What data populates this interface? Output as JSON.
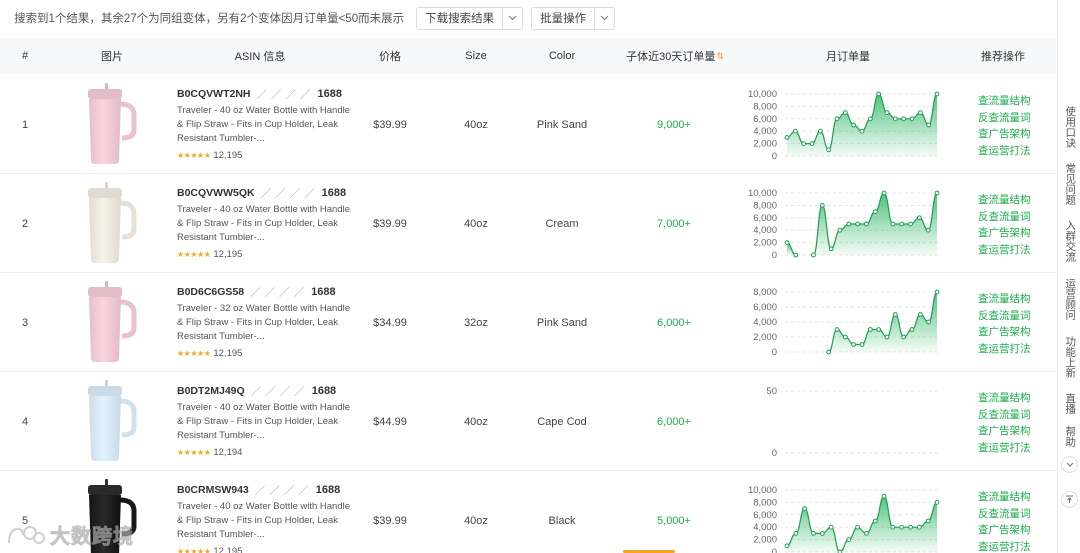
{
  "topbar": {
    "summary": "搜索到1个结果，其余27个为同组变体，另有2个变体因月订单量<50而未展示",
    "download_label": "下载搜索结果",
    "batch_label": "批量操作"
  },
  "headers": {
    "index": "#",
    "image": "图片",
    "asin_info": "ASIN 信息",
    "price": "价格",
    "size": "Size",
    "color": "Color",
    "sales30": "子体近30天订单量",
    "monthly": "月订单量",
    "actions": "推荐操作"
  },
  "action_labels": [
    "查流量结构",
    "反查流量词",
    "查广告架构",
    "查运营打法"
  ],
  "rows": [
    {
      "index": "1",
      "asin": "B0CQVWT2NH",
      "tag": "1688",
      "title": "Traveler - 40 oz Water Bottle with Handle & Flip Straw - Fits in Cup Holder, Leak Resistant Tumbler-...",
      "stars": "★★★★★",
      "reviews": "12,195",
      "price": "$39.99",
      "size": "40oz",
      "color": "Pink Sand",
      "sales": "9,000+",
      "bottle_color": "#eec9d4",
      "chart": {
        "ymax": 10000,
        "yticks": [
          "10,000",
          "8,000",
          "6,000",
          "4,000",
          "2,000",
          "0"
        ],
        "values": [
          3000,
          4000,
          2000,
          2000,
          4000,
          1000,
          6000,
          7000,
          5000,
          4000,
          6000,
          10000,
          7000,
          6000,
          6000,
          6000,
          7000,
          5000,
          10000
        ]
      }
    },
    {
      "index": "2",
      "asin": "B0CQVWW5QK",
      "tag": "1688",
      "title": "Traveler - 40 oz Water Bottle with Handle & Flip Straw - Fits in Cup Holder, Leak Resistant Tumbler-...",
      "stars": "★★★★★",
      "reviews": "12,195",
      "price": "$39.99",
      "size": "40oz",
      "color": "Cream",
      "sales": "7,000+",
      "bottle_color": "#ece6dc",
      "chart": {
        "ymax": 10000,
        "yticks": [
          "10,000",
          "8,000",
          "6,000",
          "4,000",
          "2,000",
          "0"
        ],
        "values": [
          2000,
          0,
          null,
          0,
          8000,
          1000,
          4000,
          5000,
          5000,
          5000,
          7000,
          10000,
          5000,
          5000,
          5000,
          6000,
          4000,
          10000
        ]
      }
    },
    {
      "index": "3",
      "asin": "B0D6C6GS58",
      "tag": "1688",
      "title": "Traveler - 32 oz Water Bottle with Handle & Flip Straw - Fits in Cup Holder, Leak Resistant Tumbler-...",
      "stars": "★★★★★",
      "reviews": "12,195",
      "price": "$34.99",
      "size": "32oz",
      "color": "Pink Sand",
      "sales": "6,000+",
      "bottle_color": "#eec9d4",
      "chart": {
        "ymax": 8000,
        "yticks": [
          "8,000",
          "6,000",
          "4,000",
          "2,000",
          "0"
        ],
        "values": [
          null,
          null,
          null,
          null,
          null,
          0,
          3000,
          2000,
          1000,
          1000,
          3000,
          3000,
          2000,
          5000,
          2000,
          3000,
          5000,
          4000,
          8000
        ]
      }
    },
    {
      "index": "4",
      "asin": "B0DT2MJ49Q",
      "tag": "1688",
      "title": "Traveler - 40 oz Water Bottle with Handle & Flip Straw - Fits in Cup Holder, Leak Resistant Tumbler-...",
      "stars": "★★★★★",
      "reviews": "12,194",
      "price": "$44.99",
      "size": "40oz",
      "color": "Cape Cod",
      "sales": "6,000+",
      "bottle_color": "#d6e6f2",
      "chart": {
        "ymax": 50,
        "yticks": [
          "50",
          "",
          "",
          "",
          "",
          "0"
        ],
        "values": []
      }
    },
    {
      "index": "5",
      "asin": "B0CRMSW943",
      "tag": "1688",
      "title": "Traveler - 40 oz Water Bottle with Handle & Flip Straw - Fits in Cup Holder, Leak Resistant Tumbler-...",
      "stars": "★★★★★",
      "reviews": "12,195",
      "price": "$39.99",
      "size": "40oz",
      "color": "Black",
      "sales": "5,000+",
      "bottle_color": "#1e1e1e",
      "chart": {
        "ymax": 10000,
        "yticks": [
          "10,000",
          "8,000",
          "6,000",
          "4,000",
          "2,000",
          "0"
        ],
        "values": [
          1000,
          3000,
          7000,
          3000,
          3000,
          4000,
          0,
          2000,
          4000,
          3000,
          5000,
          9000,
          4000,
          4000,
          4000,
          4000,
          5000,
          8000
        ]
      }
    }
  ],
  "side_panel": {
    "items": [
      "使用口诀",
      "常见问题",
      "入群交流",
      "运营顾问",
      "功能上新",
      "直播",
      "帮助"
    ]
  },
  "watermark": "大数跨境",
  "colors": {
    "accent_green": "#1bae4d",
    "sort_orange": "#e6a23c"
  }
}
